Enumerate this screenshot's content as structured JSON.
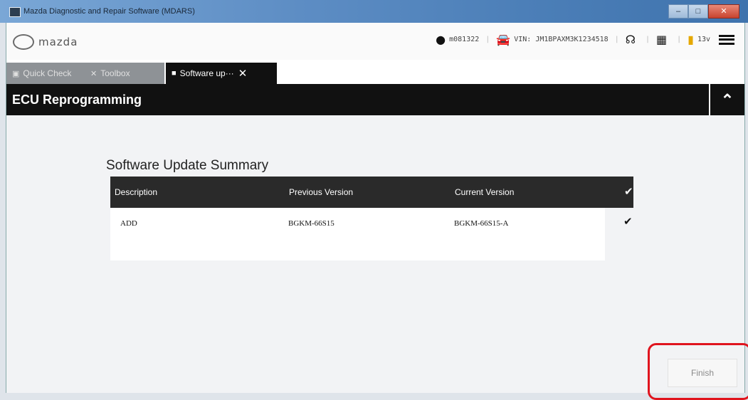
{
  "window": {
    "title": "Mazda Diagnostic and Repair Software (MDARS)"
  },
  "header": {
    "logo_text": "mazda",
    "user_id": "m081322",
    "vin": "VIN: JM1BPAXM3K1234518",
    "voltage": "13v"
  },
  "tabs": [
    {
      "label": "Quick Check",
      "icon": "car-icon"
    },
    {
      "label": "Toolbox",
      "icon": "tools-icon"
    },
    {
      "label": "Software up···",
      "icon": "document-icon",
      "active": true
    }
  ],
  "section": {
    "title": "ECU Reprogramming"
  },
  "summary": {
    "title": "Software Update Summary",
    "columns": [
      "Description",
      "Previous Version",
      "Current Version"
    ],
    "rows": [
      {
        "description": "ADD",
        "previous": "BGKM-66S15",
        "current": "BGKM-66S15-A"
      }
    ]
  },
  "actions": {
    "finish_label": "Finish"
  },
  "colors": {
    "header_bar": "#111111",
    "highlight": "#e0141e"
  }
}
